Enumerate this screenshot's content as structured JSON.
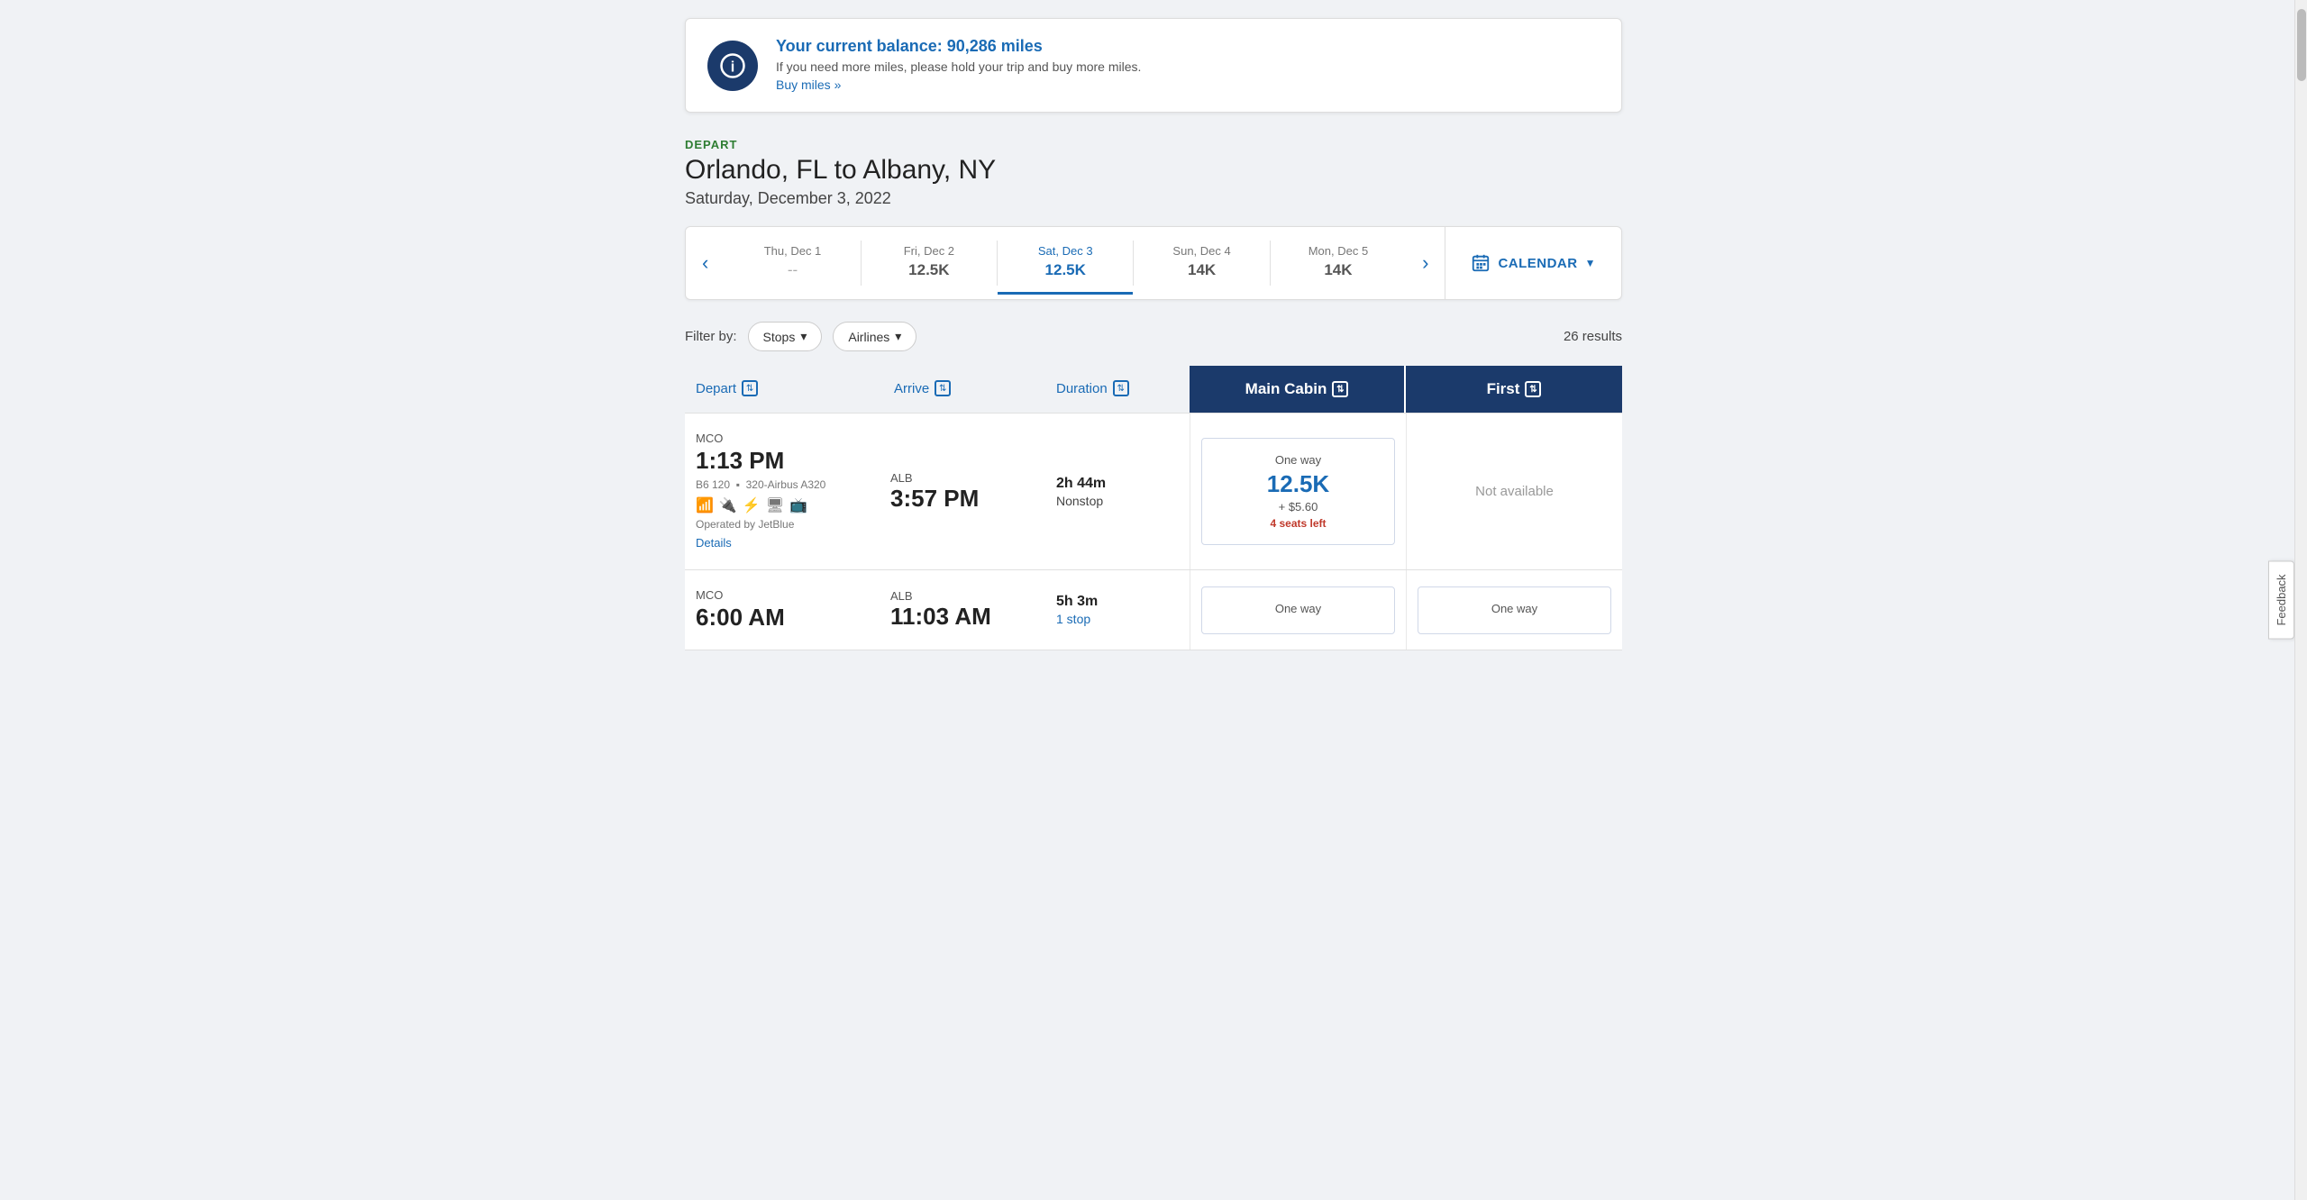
{
  "balance": {
    "title": "Your current balance: 90,286 miles",
    "subtitle": "If you need more miles, please hold your trip and buy more miles.",
    "link_text": "Buy miles »"
  },
  "depart": {
    "label": "DEPART",
    "route": "Orlando, FL to Albany, NY",
    "date": "Saturday, December 3, 2022"
  },
  "date_selector": {
    "prev_label": "‹",
    "next_label": "›",
    "dates": [
      {
        "label": "Thu, Dec 1",
        "miles": "--",
        "active": false
      },
      {
        "label": "Fri, Dec 2",
        "miles": "12.5K",
        "active": false
      },
      {
        "label": "Sat, Dec 3",
        "miles": "12.5K",
        "active": true
      },
      {
        "label": "Sun, Dec 4",
        "miles": "14K",
        "active": false
      },
      {
        "label": "Mon, Dec 5",
        "miles": "14K",
        "active": false
      }
    ],
    "calendar_label": "CALENDAR"
  },
  "filter": {
    "label": "Filter by:",
    "stops_label": "Stops",
    "airlines_label": "Airlines",
    "results": "26 results"
  },
  "table": {
    "col_depart": "Depart",
    "col_arrive": "Arrive",
    "col_duration": "Duration",
    "col_main_cabin": "Main Cabin",
    "col_first": "First"
  },
  "flights": [
    {
      "depart_airport": "MCO",
      "depart_time": "1:13 PM",
      "arrive_airport": "ALB",
      "arrive_time": "3:57 PM",
      "duration": "2h 44m",
      "stops": "Nonstop",
      "stops_color": "normal",
      "flight_number": "B6 120",
      "aircraft": "320-Airbus A320",
      "operated_by": "Operated by JetBlue",
      "details_label": "Details",
      "main_cabin": {
        "one_way": "One way",
        "miles": "12.5K",
        "fee": "+ $5.60",
        "seats": "4 seats left"
      },
      "first": {
        "available": false,
        "label": "Not available"
      }
    },
    {
      "depart_airport": "MCO",
      "depart_time": "6:00 AM",
      "arrive_airport": "ALB",
      "arrive_time": "11:03 AM",
      "duration": "5h 3m",
      "stops": "1 stop",
      "stops_color": "blue",
      "flight_number": "",
      "aircraft": "",
      "operated_by": "",
      "details_label": "",
      "main_cabin": {
        "one_way": "One way",
        "miles": "",
        "fee": "",
        "seats": ""
      },
      "first": {
        "available": true,
        "one_way": "One way",
        "miles": "",
        "fee": "",
        "seats": ""
      }
    }
  ],
  "feedback": "Feedback"
}
